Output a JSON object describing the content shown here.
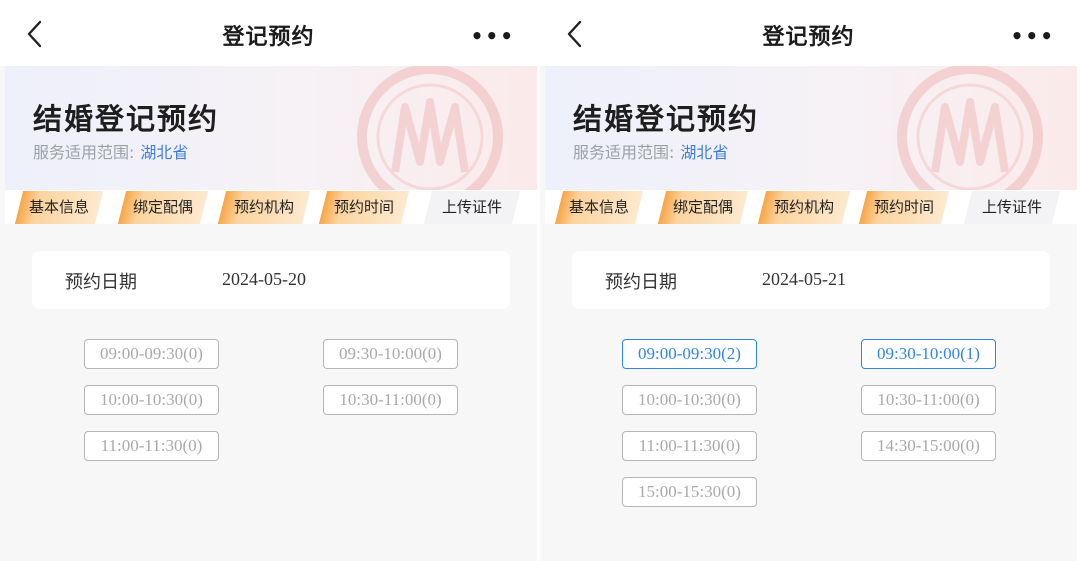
{
  "colors": {
    "accent": "#2f86e6",
    "region": "#3d7de0",
    "step_orange": "#f7a647"
  },
  "screens": [
    {
      "nav": {
        "title": "登记预约",
        "back_icon": "chevron-left-icon",
        "more": "•••"
      },
      "hero": {
        "title": "结婚登记预约",
        "scope_label": "服务适用范围:",
        "region": "湖北省"
      },
      "steps": [
        "基本信息",
        "绑定配偶",
        "预约机构",
        "预约时间",
        "上传证件"
      ],
      "date": {
        "label": "预约日期",
        "value": "2024-05-20"
      },
      "slots": [
        {
          "time": "09:00-09:30(0)",
          "available": false
        },
        {
          "time": "09:30-10:00(0)",
          "available": false
        },
        {
          "time": "10:00-10:30(0)",
          "available": false
        },
        {
          "time": "10:30-11:00(0)",
          "available": false
        },
        {
          "time": "11:00-11:30(0)",
          "available": false
        }
      ]
    },
    {
      "nav": {
        "title": "登记预约",
        "back_icon": "chevron-left-icon",
        "more": "•••"
      },
      "hero": {
        "title": "结婚登记预约",
        "scope_label": "服务适用范围:",
        "region": "湖北省"
      },
      "steps": [
        "基本信息",
        "绑定配偶",
        "预约机构",
        "预约时间",
        "上传证件"
      ],
      "date": {
        "label": "预约日期",
        "value": "2024-05-21"
      },
      "slots": [
        {
          "time": "09:00-09:30(2)",
          "available": true
        },
        {
          "time": "09:30-10:00(1)",
          "available": true
        },
        {
          "time": "10:00-10:30(0)",
          "available": false
        },
        {
          "time": "10:30-11:00(0)",
          "available": false
        },
        {
          "time": "11:00-11:30(0)",
          "available": false
        },
        {
          "time": "14:30-15:00(0)",
          "available": false
        },
        {
          "time": "15:00-15:30(0)",
          "available": false
        }
      ]
    }
  ]
}
